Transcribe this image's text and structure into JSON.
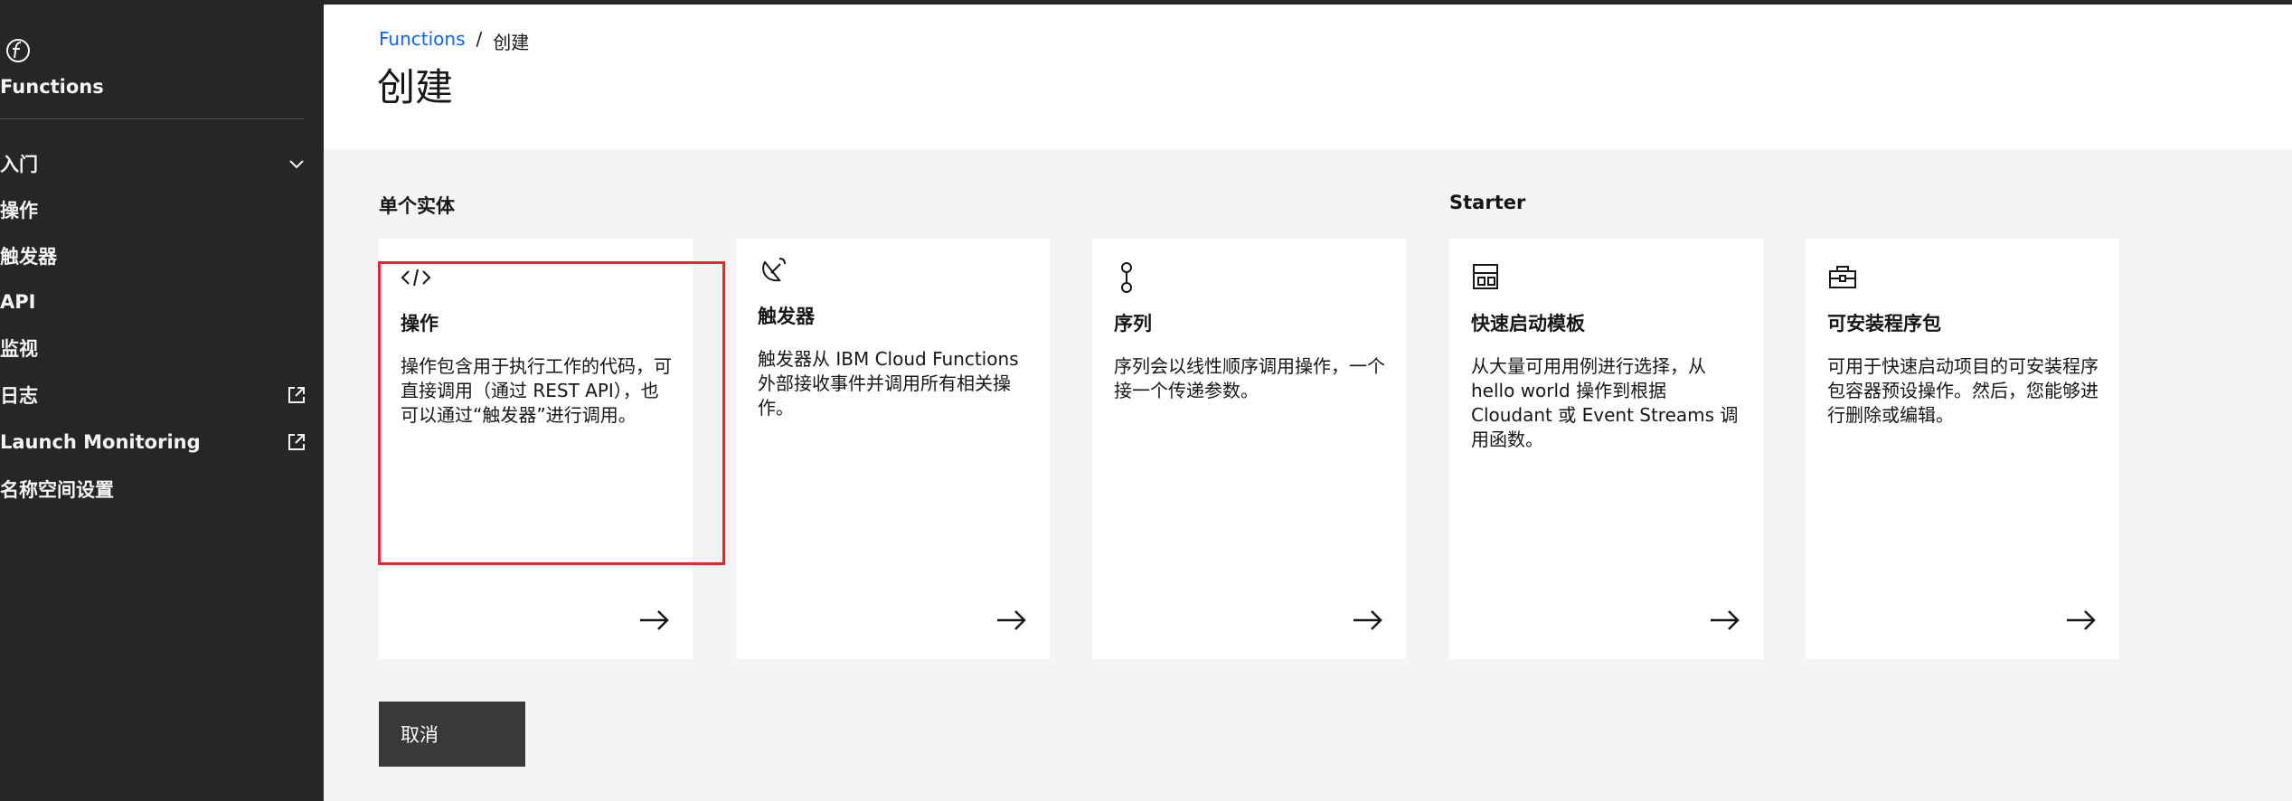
{
  "sidebar": {
    "title": "Functions",
    "items": [
      {
        "label": "入门"
      },
      {
        "label": "操作"
      },
      {
        "label": "触发器"
      },
      {
        "label": "API"
      },
      {
        "label": "监视"
      },
      {
        "label": "日志"
      },
      {
        "label": "Launch Monitoring"
      },
      {
        "label": "名称空间设置"
      }
    ]
  },
  "header": {
    "breadcrumb_root": "Functions",
    "breadcrumb_sep": "/",
    "breadcrumb_current": "创建",
    "title": "创建"
  },
  "sections": {
    "single": "单个实体",
    "starter": "Starter"
  },
  "cards": [
    {
      "title": "操作",
      "desc": "操作包含用于执行工作的代码，可直接调用（通过 REST API），也可以通过“触发器”进行调用。",
      "icon": "code-icon"
    },
    {
      "title": "触发器",
      "desc": "触发器从 IBM Cloud Functions 外部接收事件并调用所有相关操作。",
      "icon": "satellite-dish-icon"
    },
    {
      "title": "序列",
      "desc": "序列会以线性顺序调用操作，一个接一个传递参数。",
      "icon": "sequence-icon"
    },
    {
      "title": "快速启动模板",
      "desc": "从大量可用用例进行选择，从 hello world 操作到根据 Cloudant 或 Event Streams 调用函数。",
      "icon": "template-icon"
    },
    {
      "title": "可安装程序包",
      "desc": "可用于快速启动项目的可安装程序包容器预设操作。然后，您能够进行删除或编辑。",
      "icon": "toolbox-icon"
    }
  ],
  "cancel_label": "取消"
}
